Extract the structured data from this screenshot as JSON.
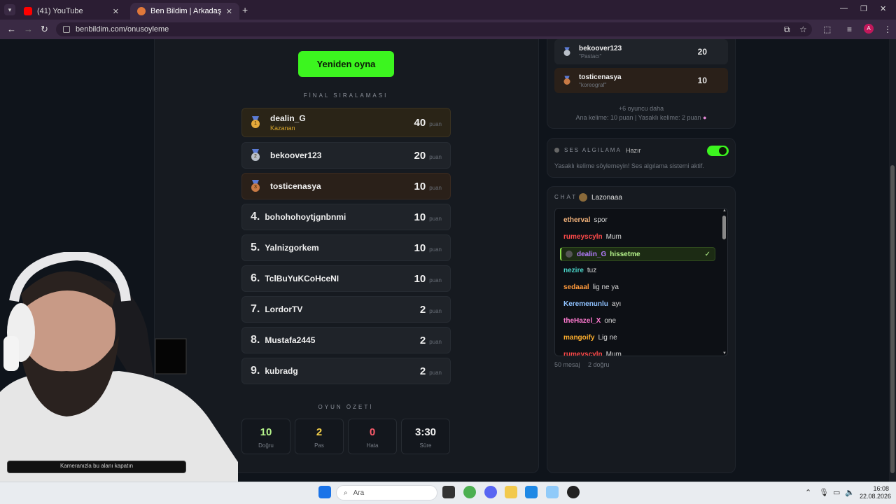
{
  "browser": {
    "tabs": [
      {
        "label": "(41) YouTube",
        "active": false
      },
      {
        "label": "Ben Bildim | Arkadaşlarınla Onl",
        "active": true
      }
    ],
    "url": "benbildim.com/onusoyleme",
    "profile_initial": "A"
  },
  "game": {
    "replay_label": "Yeniden oyna",
    "final_title": "FİNAL SIRALAMASI",
    "puan_label": "puan",
    "winner_label": "Kazanan",
    "rankings": [
      {
        "rank": "1",
        "name": "dealin_G",
        "score": "40",
        "medal": "gold"
      },
      {
        "rank": "2",
        "name": "bekoover123",
        "score": "20",
        "medal": "silver"
      },
      {
        "rank": "3",
        "name": "tosticenasya",
        "score": "10",
        "medal": "bronze"
      },
      {
        "rank": "4.",
        "name": "bohohohoytjgnbnmi",
        "score": "10"
      },
      {
        "rank": "5.",
        "name": "Yalnizgorkem",
        "score": "10"
      },
      {
        "rank": "6.",
        "name": "TclBuYuKCoHceNI",
        "score": "10"
      },
      {
        "rank": "7.",
        "name": "LordorTV",
        "score": "2"
      },
      {
        "rank": "8.",
        "name": "Mustafa2445",
        "score": "2"
      },
      {
        "rank": "9.",
        "name": "kubradg",
        "score": "2"
      }
    ],
    "summary_title": "OYUN ÖZETİ",
    "summary": [
      {
        "value": "10",
        "label": "Doğru",
        "color": "#b6f58c"
      },
      {
        "value": "2",
        "label": "Pas",
        "color": "#f5d14a"
      },
      {
        "value": "0",
        "label": "Hata",
        "color": "#ff5c6c"
      },
      {
        "value": "3:30",
        "label": "Süre",
        "color": "#f0f0f0"
      }
    ]
  },
  "sidebar": {
    "leaderboard": [
      {
        "name": "bekoover123",
        "role": "\"Pastacı\"",
        "score": "20"
      },
      {
        "name": "tosticenasya",
        "role": "\"koreograf\"",
        "score": "10"
      }
    ],
    "more_players": "+6 oyuncu daha",
    "scoring_note": "Ana kelime: 10 puan | Yasaklı kelime: 2 puan",
    "voice_title": "SES ALGILAMA",
    "voice_status": "Hazır",
    "voice_desc": "Yasaklı kelime söylemeyin! Ses algılama sistemi aktif.",
    "chat_title": "CHAT",
    "chat_channel": "Lazonaaa",
    "messages": [
      {
        "user": "etherval",
        "text": "spor",
        "color": "#f2b27a"
      },
      {
        "user": "rumeyscyln",
        "text": "Mum",
        "color": "#ff4a4a"
      },
      {
        "user": "dealin_G",
        "text": "hissetme",
        "color": "#b57cff",
        "highlight": true
      },
      {
        "user": "nezire",
        "text": "tuz",
        "color": "#4ad6c9"
      },
      {
        "user": "sedaaal",
        "text": "lig ne ya",
        "color": "#ff9a3c"
      },
      {
        "user": "Keremenunlu",
        "text": "ayı",
        "color": "#8fc2ff"
      },
      {
        "user": "theHazel_X",
        "text": "one",
        "color": "#ff7ad0"
      },
      {
        "user": "mangoify",
        "text": "Lig ne",
        "color": "#ffb02e"
      },
      {
        "user": "rumeyscyln",
        "text": "Mum",
        "color": "#ff4a4a"
      }
    ],
    "message_count": "50 mesaj",
    "correct_count": "2 doğru"
  },
  "webcam": {
    "caption": "Kameranızla bu alanı kapatın"
  },
  "taskbar": {
    "search_label": "Ara",
    "time": "16:08",
    "date": "22.08.2026"
  }
}
